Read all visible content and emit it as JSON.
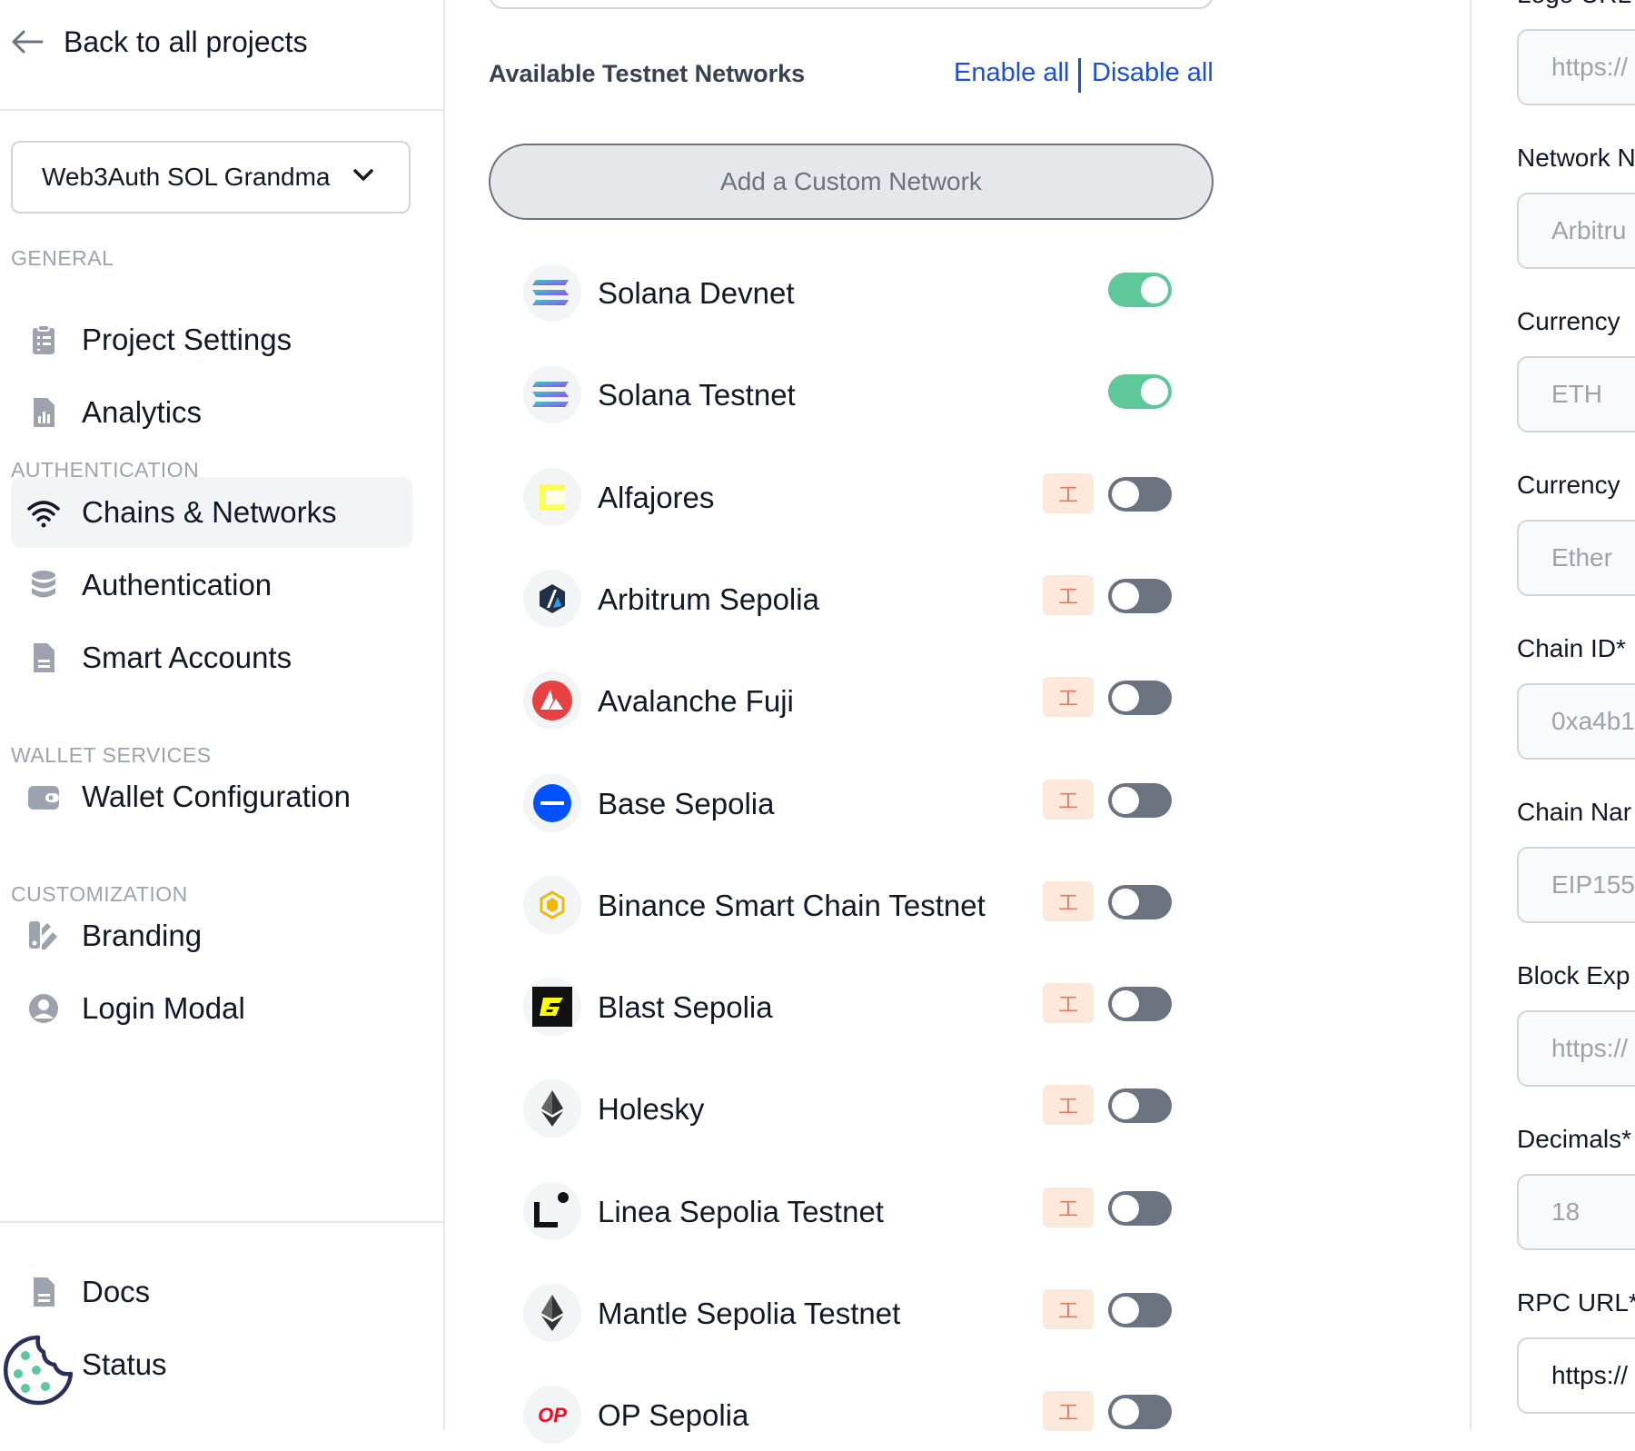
{
  "sidebar": {
    "back_label": "Back to all projects",
    "project_select_value": "Web3Auth SOL Grandma",
    "sections": {
      "general": "GENERAL",
      "authentication": "AUTHENTICATION",
      "wallet_services": "WALLET SERVICES",
      "customization": "CUSTOMIZATION"
    },
    "items": {
      "project_settings": "Project Settings",
      "analytics": "Analytics",
      "chains_networks": "Chains & Networks",
      "authentication": "Authentication",
      "smart_accounts": "Smart Accounts",
      "wallet_configuration": "Wallet Configuration",
      "branding": "Branding",
      "login_modal": "Login Modal"
    },
    "bottom": {
      "docs": "Docs",
      "status": "Status"
    }
  },
  "main": {
    "list_title": "Available Testnet Networks",
    "enable_all": "Enable all",
    "disable_all": "Disable all",
    "custom_network_button": "Add a Custom Network",
    "networks": [
      {
        "name": "Solana Devnet",
        "enabled": true,
        "testnet_badge": false,
        "icon": "solana-icon"
      },
      {
        "name": "Solana Testnet",
        "enabled": true,
        "testnet_badge": false,
        "icon": "solana-icon"
      },
      {
        "name": "Alfajores",
        "enabled": false,
        "testnet_badge": true,
        "icon": "celo-icon"
      },
      {
        "name": "Arbitrum Sepolia",
        "enabled": false,
        "testnet_badge": true,
        "icon": "arbitrum-icon"
      },
      {
        "name": "Avalanche Fuji",
        "enabled": false,
        "testnet_badge": true,
        "icon": "avalanche-icon"
      },
      {
        "name": "Base Sepolia",
        "enabled": false,
        "testnet_badge": true,
        "icon": "base-icon"
      },
      {
        "name": "Binance Smart Chain Testnet",
        "enabled": false,
        "testnet_badge": true,
        "icon": "bnb-icon"
      },
      {
        "name": "Blast Sepolia",
        "enabled": false,
        "testnet_badge": true,
        "icon": "blast-icon"
      },
      {
        "name": "Holesky",
        "enabled": false,
        "testnet_badge": true,
        "icon": "ethereum-icon"
      },
      {
        "name": "Linea Sepolia Testnet",
        "enabled": false,
        "testnet_badge": true,
        "icon": "linea-icon"
      },
      {
        "name": "Mantle Sepolia Testnet",
        "enabled": false,
        "testnet_badge": true,
        "icon": "mantle-icon"
      },
      {
        "name": "OP Sepolia",
        "enabled": false,
        "testnet_badge": true,
        "icon": "optimism-icon"
      }
    ],
    "testnet_badge_glyph": "工",
    "logo_text": {
      "optimism": "OP"
    }
  },
  "form": {
    "logo_url_label": "Logo URL",
    "logo_url_placeholder": "https://",
    "network_name_label": "Network N",
    "network_name_placeholder": "Arbitru",
    "currency_symbol_label": "Currency",
    "currency_symbol_placeholder": "ETH",
    "currency_name_label": "Currency",
    "currency_name_placeholder": "Ether",
    "chain_id_label": "Chain ID*",
    "chain_id_placeholder": "0xa4b1",
    "chain_namespace_label": "Chain Nar",
    "chain_namespace_value": "EIP155",
    "block_explorer_label": "Block Exp",
    "block_explorer_placeholder": "https://",
    "decimals_label": "Decimals*",
    "decimals_placeholder": "18",
    "rpc_url_label": "RPC URL*",
    "rpc_url_value": "https://"
  },
  "colors": {
    "accent_link": "#1d4ed8",
    "toggle_on": "#5fc89a",
    "toggle_off": "#6b7280",
    "badge_bg": "#fde8dc"
  }
}
